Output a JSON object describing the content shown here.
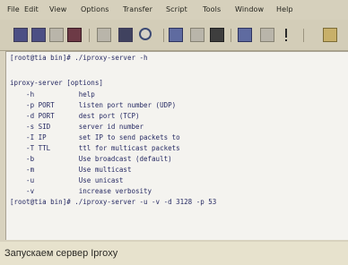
{
  "menu": [
    "File",
    "Edit",
    "View",
    "Options",
    "Transfer",
    "Script",
    "Tools",
    "Window",
    "Help"
  ],
  "toolbar_icons": [
    "new-icon",
    "open-icon",
    "save-icon",
    "print-icon",
    "find-icon",
    "copy-icon",
    "paste-icon",
    "settings-icon",
    "disconnect-icon",
    "help-icon",
    "extra-icon"
  ],
  "terminal": {
    "lines": [
      "[root@tia bin]# ./iproxy-server -h",
      "",
      "iproxy-server [options]",
      "    -h           help",
      "    -p PORT      listen port number (UDP)",
      "    -d PORT      dest port (TCP)",
      "    -s SID       server id number",
      "    -I IP        set IP to send packets to",
      "    -T TTL       ttl for multicast packets",
      "    -b           Use broadcast (default)",
      "    -m           Use multicast",
      "    -u           Use unicast",
      "    -v           increase verbosity",
      "[root@tia bin]# ./iproxy-server -u -v -d 3128 -p 53"
    ]
  },
  "caption": "Запускаем сервер Iproxy"
}
